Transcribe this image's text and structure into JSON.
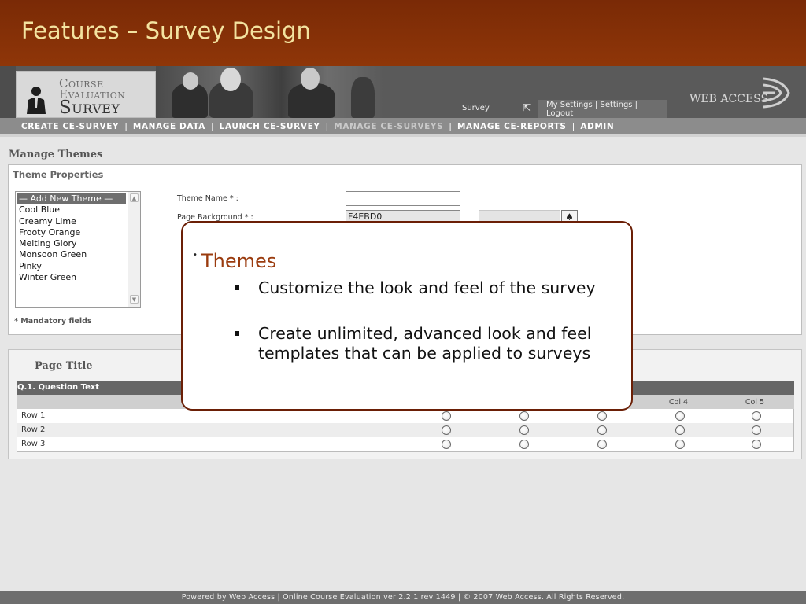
{
  "slide": {
    "title": "Features – Survey Design"
  },
  "banner": {
    "logo_line1": "Course",
    "logo_line2": "Evaluation",
    "logo_line3": "Survey",
    "survey_label": "Survey",
    "my_settings": "My Settings",
    "settings": "Settings",
    "logout": "Logout",
    "brand": "WEB ACCESS"
  },
  "nav": {
    "items": [
      {
        "label": "CREATE CE-SURVEY"
      },
      {
        "label": "MANAGE DATA"
      },
      {
        "label": "LAUNCH CE-SURVEY"
      },
      {
        "label": "MANAGE CE-SURVEYS"
      },
      {
        "label": "MANAGE CE-REPORTS"
      },
      {
        "label": "ADMIN"
      }
    ]
  },
  "manage_themes": {
    "title": "Manage Themes",
    "panel_title": "Theme Properties",
    "themes": [
      "— Add New Theme —",
      "Cool Blue",
      "Creamy Lime",
      "Frooty Orange",
      "Melting Glory",
      "Monsoon Green",
      "Pinky",
      "Winter Green"
    ],
    "fields": {
      "theme_name_label": "Theme Name * :",
      "theme_name_value": "",
      "page_bg_label": "Page Background * :",
      "page_bg_value": "F4EBD0"
    },
    "mandatory_note": "* Mandatory fields"
  },
  "preview": {
    "page_title": "Page Title",
    "question": "Q.1. Question Text",
    "columns": [
      "Col 4",
      "Col 5"
    ],
    "rows": [
      "Row 1",
      "Row 2",
      "Row 3"
    ]
  },
  "callout": {
    "heading": "Themes",
    "items": [
      "Customize the look and feel of the survey",
      "Create unlimited, advanced look and feel templates that can be applied to surveys"
    ]
  },
  "footer": {
    "text": "Powered by Web Access | Online Course Evaluation ver 2.2.1 rev 1449 | © 2007 Web Access. All Rights Reserved."
  },
  "colors": {
    "header_bg": "#8f3608",
    "title_text": "#f3e3a0",
    "callout_border": "#6b1f06",
    "callout_heading": "#9a3b0e"
  }
}
